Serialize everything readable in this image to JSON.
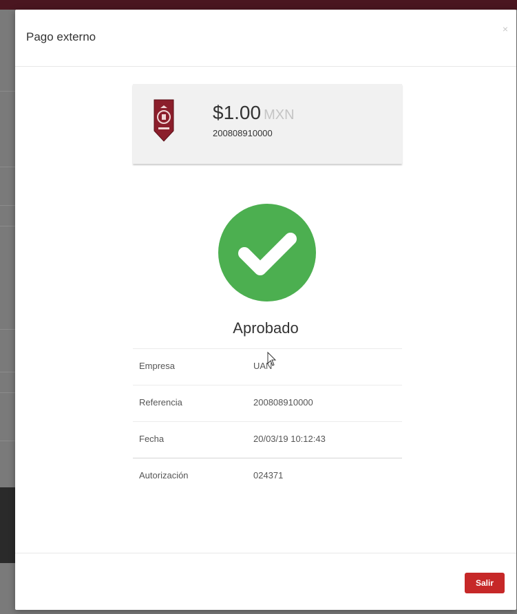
{
  "modal": {
    "title": "Pago externo",
    "close_label": "×"
  },
  "summary": {
    "amount": "$1.00",
    "currency": "MXN",
    "reference": "200808910000"
  },
  "status": {
    "label": "Aprobado",
    "color": "#4caf50",
    "icon": "checkmark-icon"
  },
  "details": [
    {
      "label": "Empresa",
      "value": "UAN"
    },
    {
      "label": "Referencia",
      "value": "200808910000"
    },
    {
      "label": "Fecha",
      "value": "20/03/19 10:12:43"
    },
    {
      "label": "Autorización",
      "value": "024371"
    }
  ],
  "footer": {
    "exit_label": "Salir"
  },
  "colors": {
    "accent": "#c62828",
    "brand_dark": "#4a1620"
  }
}
